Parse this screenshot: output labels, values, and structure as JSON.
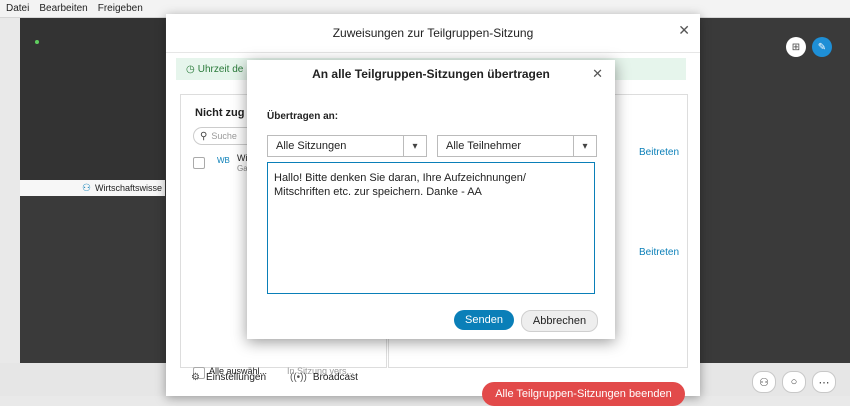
{
  "menubar": {
    "items": [
      "Datei",
      "Bearbeiten",
      "Freigeben"
    ]
  },
  "meeting": {
    "tile_label": "Wirtschaftswisse"
  },
  "assign_dialog": {
    "title": "Zuweisungen zur Teilgruppen-Sitzung",
    "banner": "Uhrzeit de",
    "panel_title": "Nicht zug",
    "search_placeholder": "Suche",
    "row_avatar": "WB",
    "row_name": "Wi",
    "row_sub": "Ga",
    "select_all": "Alle auswähl...",
    "in_session": "In Sitzung vers...",
    "join_1": "Beitreten",
    "join_2": "Beitreten",
    "settings": "Einstellungen",
    "broadcast": "Broadcast",
    "end_all": "Alle Teilgruppen-Sitzungen beenden"
  },
  "broadcast_dialog": {
    "title": "An alle Teilgruppen-Sitzungen übertragen",
    "label": "Übertragen an:",
    "sessions_select": "Alle Sitzungen",
    "participants_select": "Alle Teilnehmer",
    "message": "Hallo! Bitte denken Sie daran, Ihre Aufzeichnungen/\nMitschriften etc. zur speichern. Danke - AA",
    "send": "Senden",
    "cancel": "Abbrechen"
  },
  "colors": {
    "accent": "#0a7fb8",
    "danger": "#e24a4a",
    "banner_bg": "#e6f5ec"
  }
}
